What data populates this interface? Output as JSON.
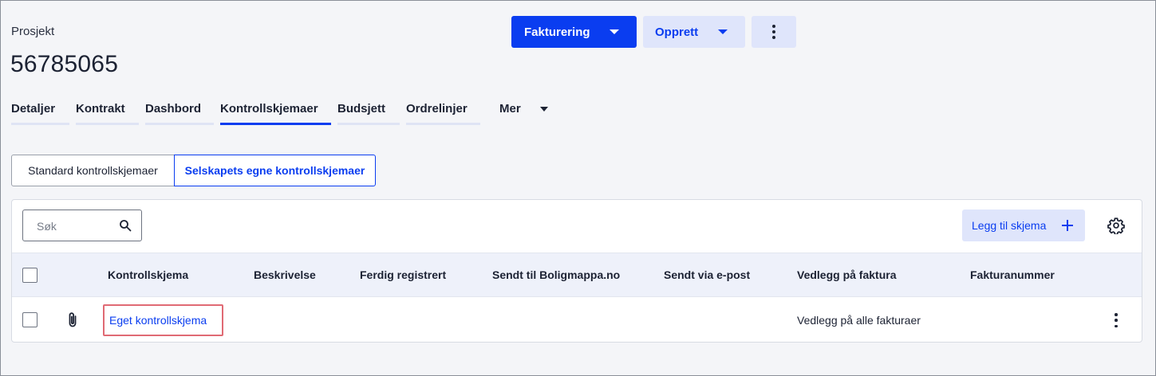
{
  "header": {
    "breadcrumb": "Prosjekt",
    "project_number": "56785065",
    "invoice_button": "Fakturering",
    "create_button": "Opprett"
  },
  "tabs": [
    {
      "label": "Detaljer",
      "active": false
    },
    {
      "label": "Kontrakt",
      "active": false
    },
    {
      "label": "Dashbord",
      "active": false
    },
    {
      "label": "Kontrollskjemaer",
      "active": true
    },
    {
      "label": "Budsjett",
      "active": false
    },
    {
      "label": "Ordrelinjer",
      "active": false
    }
  ],
  "tab_more": "Mer",
  "segments": {
    "standard": "Standard kontrollskjemaer",
    "own": "Selskapets egne kontrollskjemaer",
    "selected": "own"
  },
  "toolbar": {
    "search_placeholder": "Søk",
    "add_button": "Legg til skjema"
  },
  "table": {
    "columns": [
      "Kontrollskjema",
      "Beskrivelse",
      "Ferdig registrert",
      "Sendt til Boligmappa.no",
      "Sendt via e-post",
      "Vedlegg på faktura",
      "Fakturanummer"
    ],
    "rows": [
      {
        "kontrollskjema": "Eget kontrollskjema",
        "beskrivelse": "",
        "ferdig_registrert": "",
        "sendt_boligmappa": "",
        "sendt_epost": "",
        "vedlegg_faktura": "Vedlegg på alle fakturaer",
        "fakturanummer": ""
      }
    ]
  },
  "colors": {
    "primary": "#0a3df0",
    "primary_light": "#dfe5fb",
    "highlight_border": "#e06a74"
  }
}
